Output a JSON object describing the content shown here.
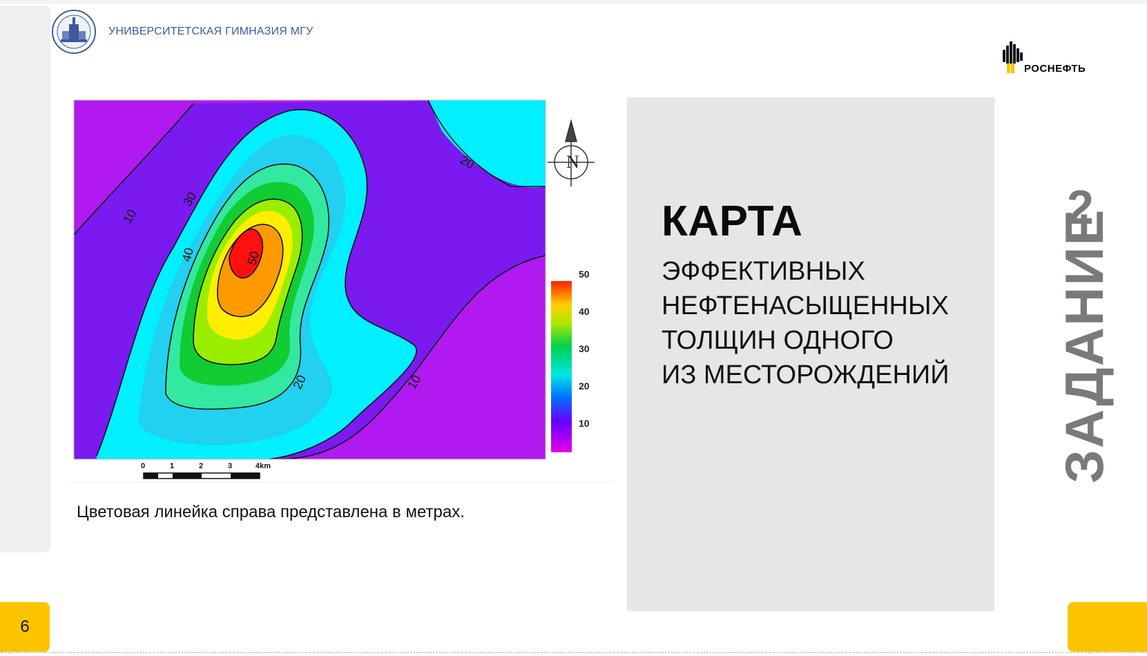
{
  "header": {
    "school_name": "УНИВЕРСИТЕТСКАЯ ГИМНАЗИЯ МГУ",
    "sponsor_name": "РОСНЕФТЬ"
  },
  "map": {
    "contour_labels": [
      "10",
      "20",
      "30",
      "40",
      "50",
      "20",
      "10"
    ],
    "compass_label": "N",
    "colorbar_ticks": [
      "50",
      "40",
      "30",
      "20",
      "10"
    ],
    "scale_ticks": [
      "0",
      "1",
      "2",
      "3",
      "4km"
    ]
  },
  "caption": "Цветовая линейка справа представлена в метрах.",
  "panel": {
    "title": "КАРТА",
    "subtitle_lines": [
      "ЭФФЕКТИВНЫХ",
      "НЕФТЕНАСЫЩЕННЫХ",
      "ТОЛЩИН ОДНОГО",
      "ИЗ МЕСТОРОЖДЕНИЙ"
    ]
  },
  "task": {
    "label": "ЗАДАНИЕ",
    "number": "2"
  },
  "footer": {
    "page_number": "6"
  },
  "colors": {
    "accent_yellow": "#fcc400",
    "panel_gray": "#e6e6e6",
    "school_blue": "#3d5a9e"
  }
}
